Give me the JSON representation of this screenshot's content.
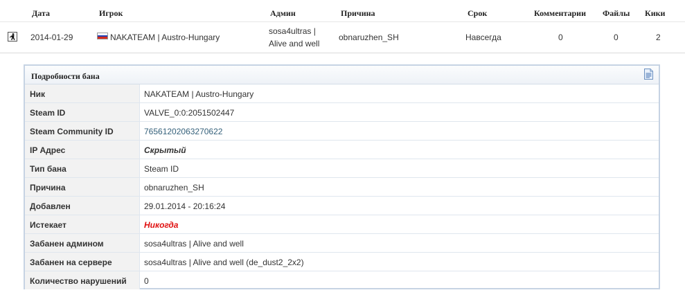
{
  "table": {
    "headers": {
      "date": "Дата",
      "player": "Игрок",
      "admin": "Админ",
      "reason": "Причина",
      "length": "Срок",
      "comments": "Комментарии",
      "files": "Файлы",
      "kicks": "Кики"
    },
    "row": {
      "game_icon": "counter-strike-icon",
      "date": "2014-01-29",
      "flag_icon": "russia-flag-icon",
      "player": "NAKATEAM | Austro-Hungary",
      "admin_line1": "sosa4ultras |",
      "admin_line2": "Alive and well",
      "reason": "obnaruzhen_SH",
      "length": "Навсегда",
      "comments": "0",
      "files": "0",
      "kicks": "2"
    }
  },
  "details": {
    "title": "Подробности бана",
    "icon": "document-icon",
    "rows": [
      {
        "label": "Ник",
        "value": "NAKATEAM | Austro-Hungary"
      },
      {
        "label": "Steam ID",
        "value": "VALVE_0:0:2051502447"
      },
      {
        "label": "Steam Community ID",
        "value": "76561202063270622"
      },
      {
        "label": "IP Адрес",
        "value": "Скрытый"
      },
      {
        "label": "Тип бана",
        "value": "Steam ID"
      },
      {
        "label": "Причина",
        "value": "obnaruzhen_SH"
      },
      {
        "label": "Добавлен",
        "value": "29.01.2014 - 20:16:24"
      },
      {
        "label": "Истекает",
        "value": "Никогда"
      },
      {
        "label": "Забанен админом",
        "value": "sosa4ultras | Alive and well"
      },
      {
        "label": "Забанен на сервере",
        "value": "sosa4ultras | Alive and well (de_dust2_2x2)"
      },
      {
        "label": "Количество нарушений",
        "value": "0"
      }
    ]
  },
  "colors": {
    "panel_border": "#c6d3e3",
    "link": "#34607a",
    "never": "#e01010"
  }
}
